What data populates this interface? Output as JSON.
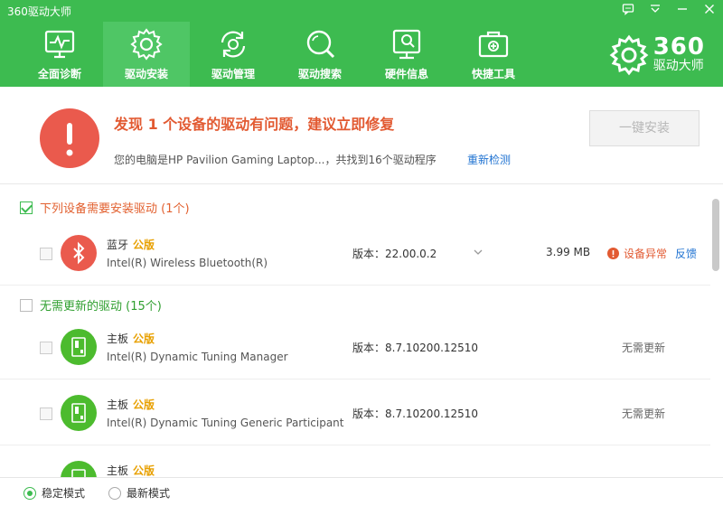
{
  "app": {
    "title": "360驱动大师"
  },
  "nav": {
    "items": [
      {
        "label": "全面诊断",
        "icon": "monitor-pulse-icon"
      },
      {
        "label": "驱动安装",
        "icon": "gear-icon",
        "active": true
      },
      {
        "label": "驱动管理",
        "icon": "refresh-gear-icon"
      },
      {
        "label": "驱动搜索",
        "icon": "search-icon"
      },
      {
        "label": "硬件信息",
        "icon": "hardware-info-icon"
      },
      {
        "label": "快捷工具",
        "icon": "toolbox-icon"
      }
    ]
  },
  "brand": {
    "number": "360",
    "name": "驱动大师"
  },
  "alert": {
    "title": "发现 1 个设备的驱动有问题，建议立即修复",
    "description": "您的电脑是HP Pavilion Gaming Laptop...，共找到16个驱动程序",
    "recheck_link": "重新检测",
    "install_button": "一键安装"
  },
  "sections": {
    "need_install": {
      "label": "下列设备需要安装驱动 (1个)"
    },
    "no_update": {
      "label": "无需更新的驱动 (15个)"
    }
  },
  "rows": [
    {
      "category": "蓝牙",
      "badge": "公版",
      "name": "Intel(R) Wireless Bluetooth(R)",
      "version": "版本：22.00.0.2",
      "size": "3.99 MB",
      "status": "设备异常",
      "feedback": "反馈"
    },
    {
      "category": "主板",
      "badge": "公版",
      "name": "Intel(R) Dynamic Tuning Manager",
      "version": "版本：8.7.10200.12510",
      "status": "无需更新"
    },
    {
      "category": "主板",
      "badge": "公版",
      "name": "Intel(R) Dynamic Tuning Generic Participant",
      "version": "版本：8.7.10200.12510",
      "status": "无需更新"
    },
    {
      "category": "主板",
      "badge": "公版"
    }
  ],
  "footer": {
    "mode_stable": "稳定模式",
    "mode_latest": "最新模式"
  },
  "colors": {
    "brand_green": "#3dbb50",
    "alert_red": "#ea5a4d",
    "badge_orange": "#e8a000",
    "link_blue": "#2274d2"
  }
}
